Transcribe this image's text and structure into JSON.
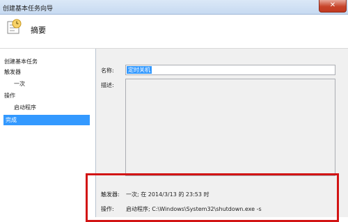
{
  "window": {
    "title": "创建基本任务向导",
    "close_glyph": "✕"
  },
  "header": {
    "heading": "摘要",
    "icon": "task-clock-icon"
  },
  "sidebar": {
    "steps": [
      {
        "label": "创建基本任务"
      },
      {
        "label": "触发器"
      },
      {
        "label": "一次"
      },
      {
        "label": "操作"
      },
      {
        "label": "启动程序"
      },
      {
        "label": "完成"
      }
    ]
  },
  "form": {
    "name_label": "名称:",
    "name_value": "定时关机",
    "desc_label": "描述:",
    "desc_value": ""
  },
  "summary": {
    "trigger_label": "触发器:",
    "trigger_value": "一次; 在 2014/3/13 的 23:53 时",
    "action_label": "操作:",
    "action_value": "启动程序; C:\\Windows\\System32\\shutdown.exe -s"
  },
  "colors": {
    "selection": "#3399ff",
    "highlight_border": "#d21414"
  }
}
